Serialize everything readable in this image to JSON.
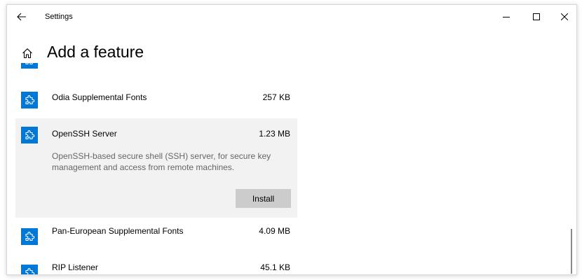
{
  "window": {
    "app_title": "Settings",
    "controls": [
      "minimize-icon",
      "maximize-icon",
      "close-icon"
    ]
  },
  "header": {
    "title": "Add a feature",
    "icon": "home-icon"
  },
  "colors": {
    "accent": "#0078d7",
    "expanded_bg": "#f2f2f2",
    "button_bg": "#cccccc",
    "desc_text": "#666666"
  },
  "features": [
    {
      "name": "",
      "size": "",
      "icon": "puzzle-icon",
      "partial": true
    },
    {
      "name": "Odia Supplemental Fonts",
      "size": "257 KB",
      "icon": "puzzle-icon"
    },
    {
      "name": "OpenSSH Server",
      "size": "1.23 MB",
      "icon": "puzzle-icon",
      "expanded": true,
      "description": "OpenSSH-based secure shell (SSH) server, for secure key management and access from remote machines.",
      "action_label": "Install"
    },
    {
      "name": "Pan-European Supplemental Fonts",
      "size": "4.09 MB",
      "icon": "puzzle-icon"
    },
    {
      "name": "RIP Listener",
      "size": "45.1 KB",
      "icon": "puzzle-icon"
    }
  ]
}
